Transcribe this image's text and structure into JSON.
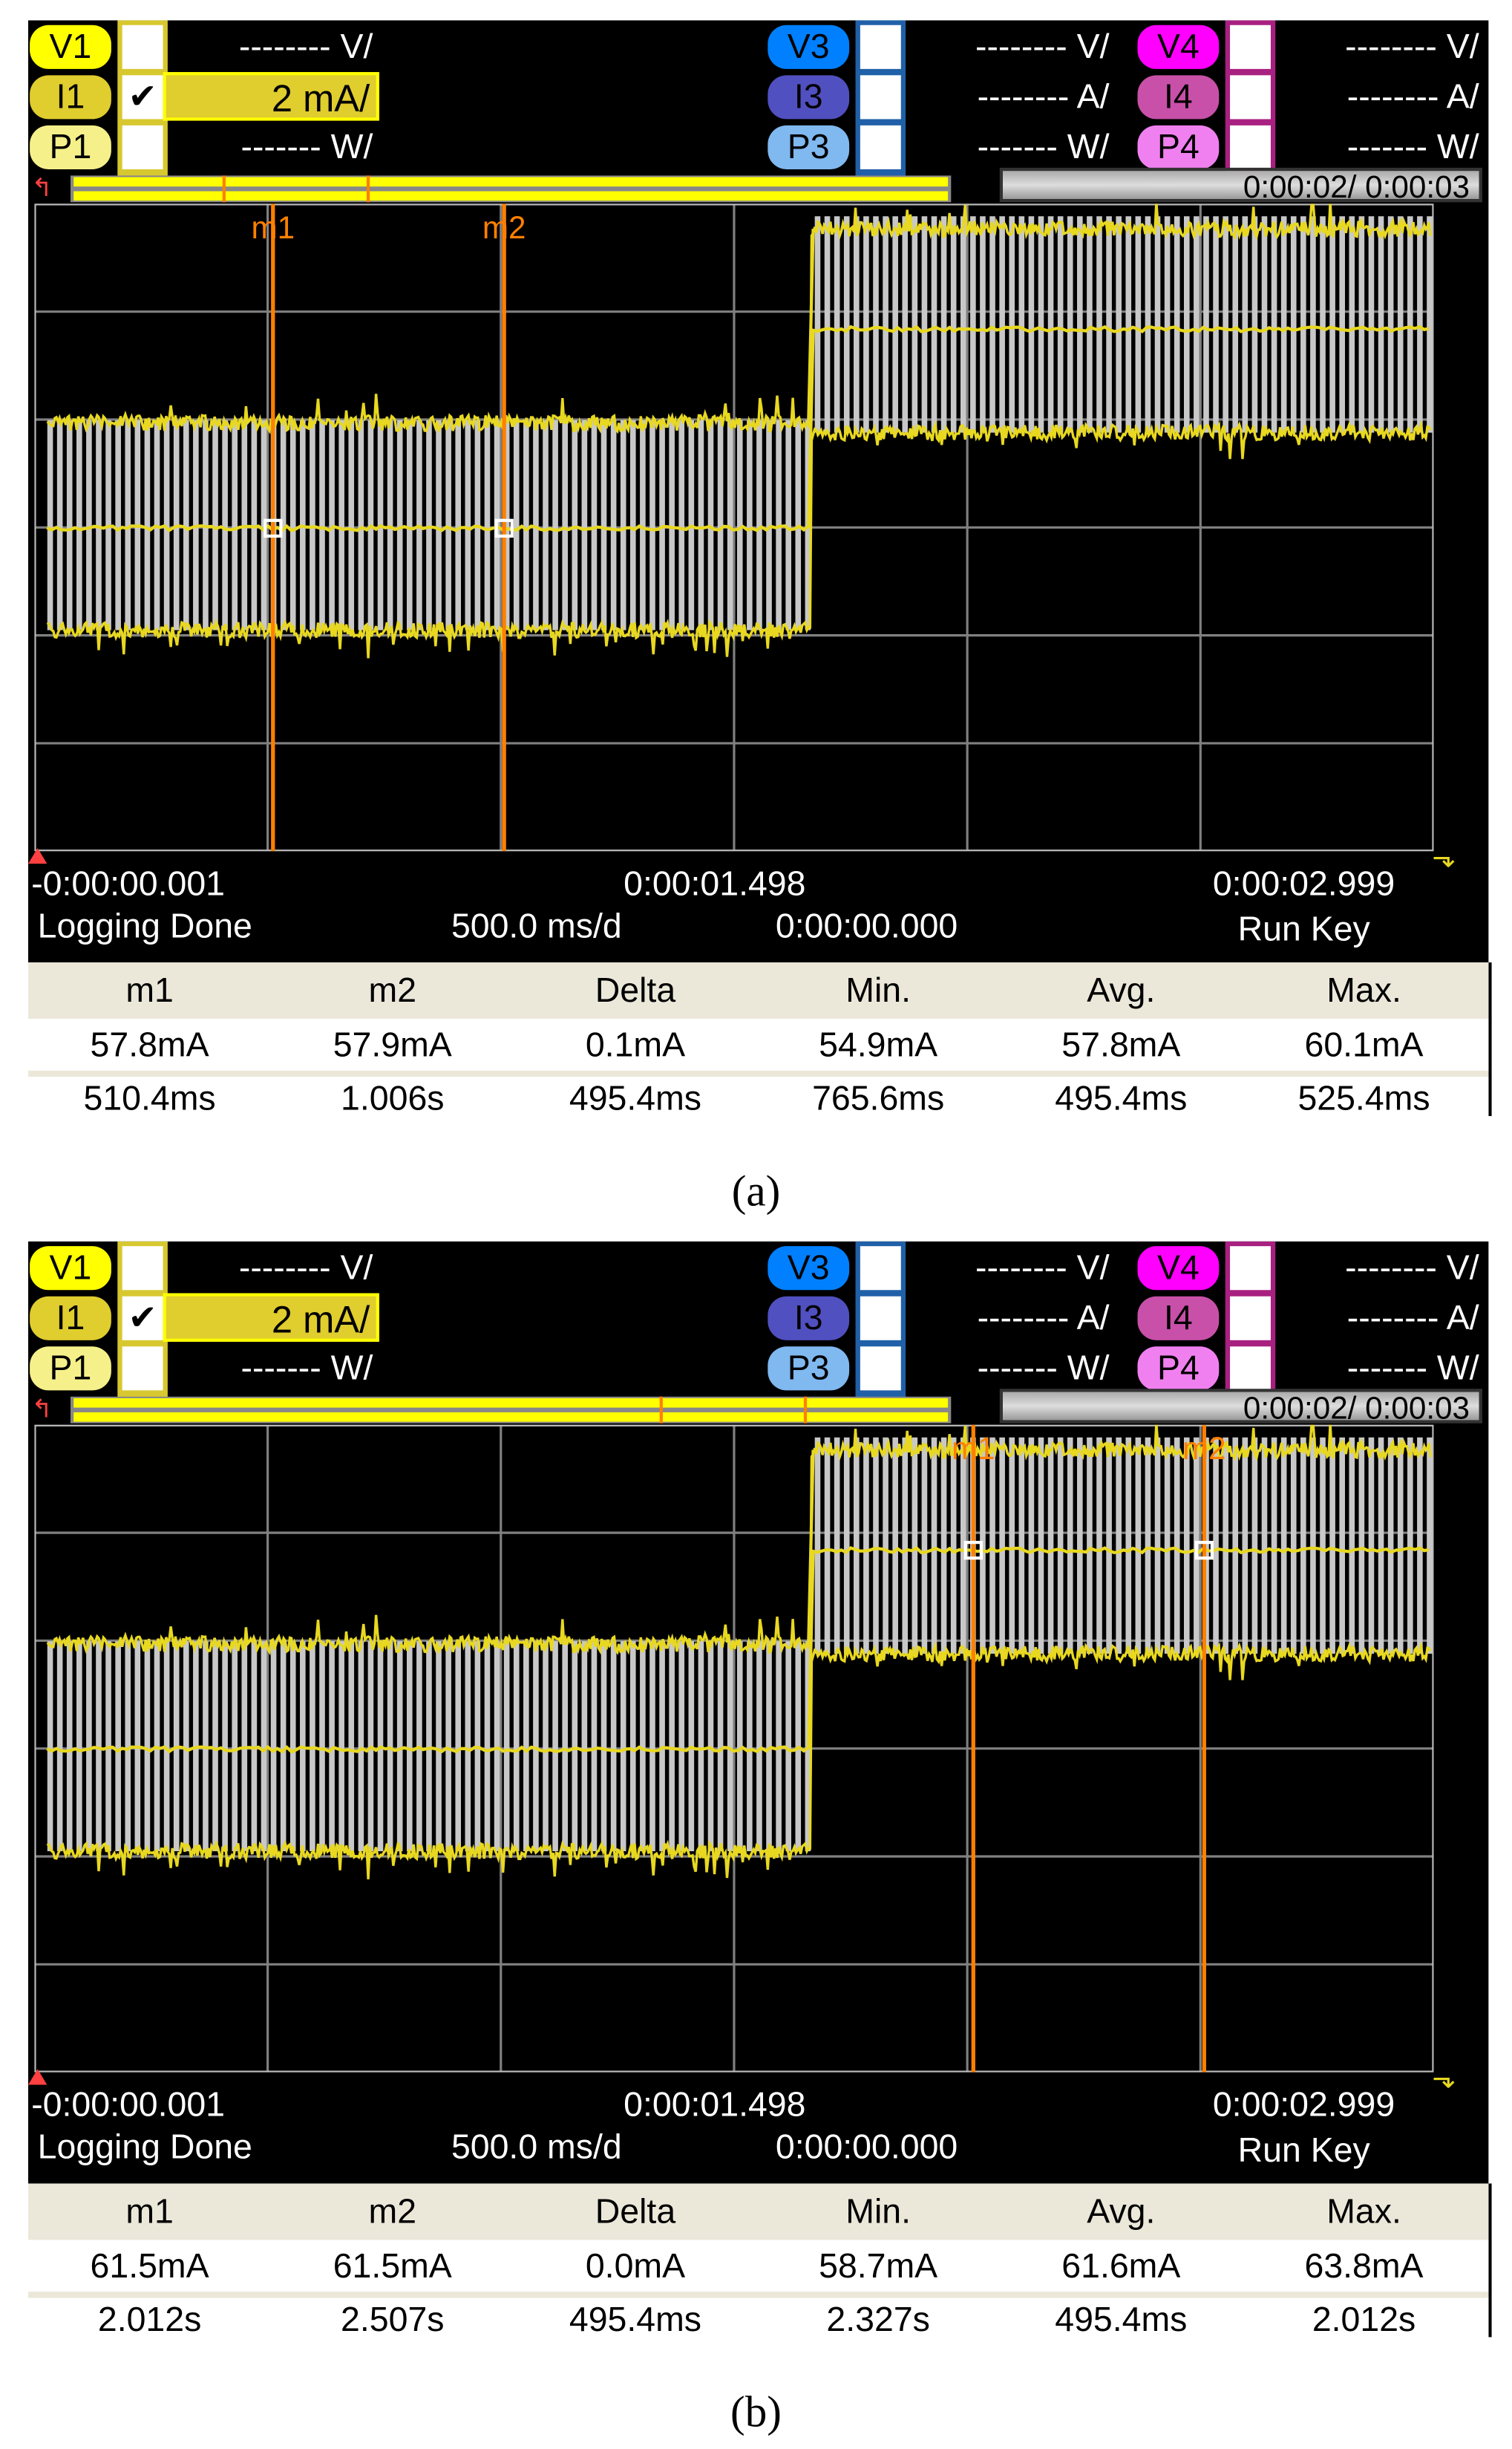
{
  "colors": {
    "v1": "#ffff00",
    "i1": "#e0cd2e",
    "p1": "#f5f08a",
    "v3": "#0080ff",
    "i3": "#5050c0",
    "p3": "#80b8f0",
    "v4": "#ff00ff",
    "i4": "#c850a8",
    "p4": "#f080f0",
    "trace": "#e8d820",
    "marker": "#ff8000",
    "bars": "#c8c8c8",
    "grid": "#808080"
  },
  "time_axis_s": [
    -0.001,
    2.999
  ],
  "panels": [
    {
      "caption": "(a)",
      "channels": {
        "v1": {
          "label": "V1",
          "unit": "-------- V/"
        },
        "i1": {
          "label": "I1",
          "check": "✔",
          "unit": "2 mA/"
        },
        "p1": {
          "label": "P1",
          "unit": "------- W/"
        },
        "v3": {
          "label": "V3",
          "unit": "-------- V/"
        },
        "i3": {
          "label": "I3",
          "unit": "-------- A/"
        },
        "p3": {
          "label": "P3",
          "unit": "------- W/"
        },
        "v4": {
          "label": "V4",
          "unit": "-------- V/"
        },
        "i4": {
          "label": "I4",
          "unit": "-------- A/"
        },
        "p4": {
          "label": "P4",
          "unit": "------- W/"
        }
      },
      "elapsed": "0:00:02/ 0:00:03",
      "marker_labels": [
        "m1",
        "m2"
      ],
      "marker_times_s": [
        0.5104,
        1.006
      ],
      "time_start": "-0:00:00.001",
      "time_mid": "0:00:01.498",
      "time_end": "0:00:02.999",
      "status": "Logging Done",
      "timebase": "500.0 ms/d",
      "offset": "0:00:00.000",
      "trigger": "Run Key",
      "headers": [
        "m1",
        "m2",
        "Delta",
        "Min.",
        "Avg.",
        "Max."
      ],
      "values": [
        "57.8mA",
        "57.9mA",
        "0.1mA",
        "54.9mA",
        "57.8mA",
        "60.1mA"
      ],
      "times": [
        "510.4ms",
        "1.006s",
        "495.4ms",
        "765.6ms",
        "495.4ms",
        "525.4ms"
      ]
    },
    {
      "caption": "(b)",
      "channels": {
        "v1": {
          "label": "V1",
          "unit": "-------- V/"
        },
        "i1": {
          "label": "I1",
          "check": "✔",
          "unit": "2 mA/"
        },
        "p1": {
          "label": "P1",
          "unit": "------- W/"
        },
        "v3": {
          "label": "V3",
          "unit": "-------- V/"
        },
        "i3": {
          "label": "I3",
          "unit": "-------- A/"
        },
        "p3": {
          "label": "P3",
          "unit": "------- W/"
        },
        "v4": {
          "label": "V4",
          "unit": "-------- V/"
        },
        "i4": {
          "label": "I4",
          "unit": "-------- A/"
        },
        "p4": {
          "label": "P4",
          "unit": "------- W/"
        }
      },
      "elapsed": "0:00:02/ 0:00:03",
      "marker_labels": [
        "m1",
        "m2"
      ],
      "marker_times_s": [
        2.012,
        2.507
      ],
      "time_start": "-0:00:00.001",
      "time_mid": "0:00:01.498",
      "time_end": "0:00:02.999",
      "status": "Logging Done",
      "timebase": "500.0 ms/d",
      "offset": "0:00:00.000",
      "trigger": "Run Key",
      "headers": [
        "m1",
        "m2",
        "Delta",
        "Min.",
        "Avg.",
        "Max."
      ],
      "values": [
        "61.5mA",
        "61.5mA",
        "0.0mA",
        "58.7mA",
        "61.6mA",
        "63.8mA"
      ],
      "times": [
        "2.012s",
        "2.507s",
        "495.4ms",
        "2.327s",
        "495.4ms",
        "2.012s"
      ]
    }
  ]
}
